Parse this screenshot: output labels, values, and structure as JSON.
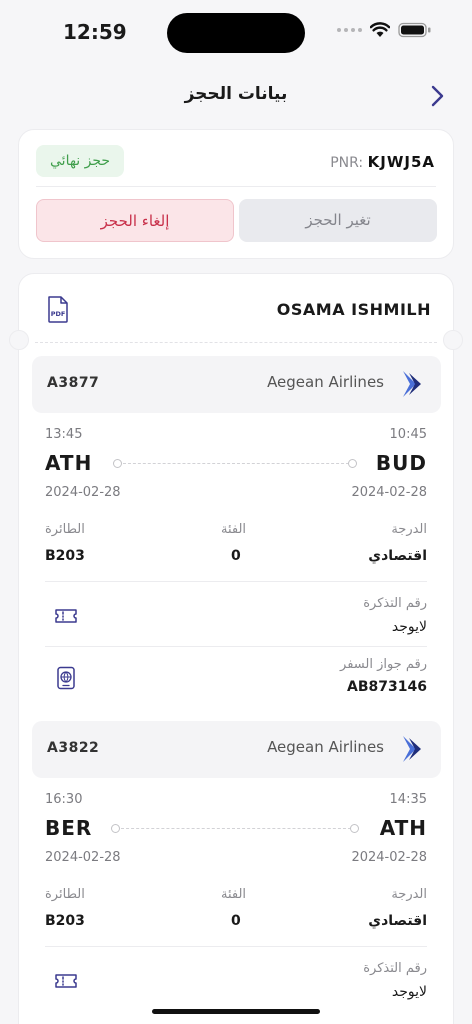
{
  "status": {
    "time": "12:59"
  },
  "header": {
    "title": "بيانات الحجز"
  },
  "booking": {
    "status_badge": "حجز نهائي",
    "pnr_label": "PNR:",
    "pnr_value": "KJWJ5A",
    "cancel_label": "إلغاء الحجز",
    "change_label": "تغير الحجز"
  },
  "passenger": {
    "name": "OSAMA ISHMILH"
  },
  "segments": [
    {
      "flight_no": "A3877",
      "airline": "Aegean Airlines",
      "dep_time": "10:45",
      "dep_code": "BUD",
      "dep_date": "2024-02-28",
      "arr_time": "13:45",
      "arr_code": "ATH",
      "arr_date": "2024-02-28",
      "class_label": "الدرجة",
      "class_value": "اقتصادي",
      "category_label": "الفئة",
      "category_value": "0",
      "aircraft_label": "الطائرة",
      "aircraft_value": "B203",
      "ticket_label": "رقم التذكرة",
      "ticket_value": "لايوجد",
      "passport_label": "رقم جواز السفر",
      "passport_value": "AB873146"
    },
    {
      "flight_no": "A3822",
      "airline": "Aegean Airlines",
      "dep_time": "14:35",
      "dep_code": "ATH",
      "dep_date": "2024-02-28",
      "arr_time": "16:30",
      "arr_code": "BER",
      "arr_date": "2024-02-28",
      "class_label": "الدرجة",
      "class_value": "اقتصادي",
      "category_label": "الفئة",
      "category_value": "0",
      "aircraft_label": "الطائرة",
      "aircraft_value": "B203",
      "ticket_label": "رقم التذكرة",
      "ticket_value": "لايوجد"
    }
  ],
  "colors": {
    "accent": "#3b3a8f",
    "success": "#3f9e4b",
    "danger": "#c8304a"
  },
  "icons": [
    "back-chevron-icon",
    "pdf-icon",
    "airline-logo-icon",
    "ticket-icon",
    "passport-icon",
    "wifi-icon",
    "battery-icon"
  ]
}
